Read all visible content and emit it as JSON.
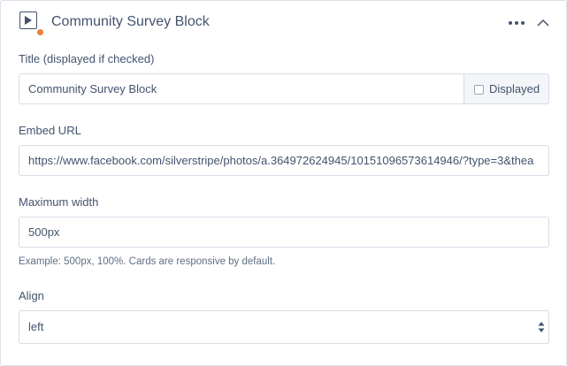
{
  "block": {
    "title": "Community Survey Block",
    "icon": "video-play-icon",
    "status_color": "#ed7d3a"
  },
  "header_actions": {
    "more_icon": "more-horizontal-icon",
    "collapse_icon": "chevron-up-icon"
  },
  "fields": {
    "title": {
      "label": "Title (displayed if checked)",
      "value": "Community Survey Block",
      "displayed_label": "Displayed",
      "displayed_checked": false
    },
    "embed_url": {
      "label": "Embed URL",
      "value": "https://www.facebook.com/silverstripe/photos/a.364972624945/10151096573614946/?type=3&thea"
    },
    "max_width": {
      "label": "Maximum width",
      "value": "500px",
      "help": "Example: 500px, 100%. Cards are responsive by default."
    },
    "align": {
      "label": "Align",
      "value": "left"
    }
  }
}
